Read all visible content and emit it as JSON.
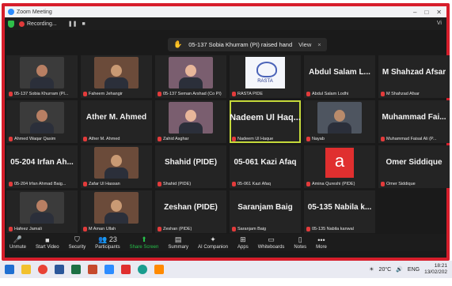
{
  "window": {
    "title": "Zoom Meeting"
  },
  "recording": {
    "label": "Recording...",
    "pause": "❚❚",
    "stop": "■"
  },
  "view_label": "Vi",
  "notification": {
    "text": "05-137 Sobia Khurram (PI) raised hand",
    "view": "View",
    "close": "×"
  },
  "participants": [
    {
      "name": "05-137 Sobia Khurram (PI...",
      "kind": "video"
    },
    {
      "name": "Faheem Jehangir",
      "kind": "video"
    },
    {
      "name": "05-137 Seman Arshad (Co PI)",
      "kind": "video"
    },
    {
      "name": "RASTA PIDE",
      "kind": "logo",
      "logo_text": "RASTA"
    },
    {
      "name": "Abdul Salam Lodhi",
      "kind": "text",
      "display": "Abdul Salam L..."
    },
    {
      "name": "M Shahzad Afsar",
      "kind": "text",
      "display": "M Shahzad Afsar"
    },
    {
      "name": "Ahmed Waqar Qasim",
      "kind": "video"
    },
    {
      "name": "Ather M. Ahmed",
      "kind": "text",
      "display": "Ather M. Ahmed"
    },
    {
      "name": "Zahid Asghar",
      "kind": "video"
    },
    {
      "name": "Nadeem Ul Haque",
      "kind": "text",
      "display": "Nadeem Ul Haq...",
      "active": true
    },
    {
      "name": "Nayab",
      "kind": "video"
    },
    {
      "name": "Muhammad Faisal Ali (P...",
      "kind": "text",
      "display": "Muhammad Fai..."
    },
    {
      "name": "05-204 Irfan Ahmad Baig...",
      "kind": "text",
      "display": "05-204 Irfan Ah..."
    },
    {
      "name": "Zafar Ul Hassan",
      "kind": "video"
    },
    {
      "name": "Shahid (PIDE)",
      "kind": "text",
      "display": "Shahid (PIDE)"
    },
    {
      "name": "05-061 Kazi Afaq",
      "kind": "text",
      "display": "05-061 Kazi Afaq"
    },
    {
      "name": "Amina Qureshi (PIDE)",
      "kind": "logo_a",
      "logo_text": "a"
    },
    {
      "name": "Omer Siddique",
      "kind": "text",
      "display": "Omer Siddique"
    },
    {
      "name": "Hafeez Jamali",
      "kind": "video"
    },
    {
      "name": "M Aman Ullah",
      "kind": "video"
    },
    {
      "name": "Zeshan (PIDE)",
      "kind": "text",
      "display": "Zeshan (PIDE)"
    },
    {
      "name": "Saranjam Baig",
      "kind": "text",
      "display": "Saranjam Baig"
    },
    {
      "name": "05-135 Nabila kanwal",
      "kind": "text",
      "display": "05-135 Nabila k..."
    }
  ],
  "toolbar": {
    "unmute": "Unmute",
    "start_video": "Start Video",
    "security": "Security",
    "participants": "Participants",
    "participants_count": "23",
    "share_screen": "Share Screen",
    "summary": "Summary",
    "ai_companion": "AI Companion",
    "apps": "Apps",
    "whiteboards": "Whiteboards",
    "notes": "Notes",
    "more": "More"
  },
  "taskbar": {
    "weather": "20°C",
    "language": "ENG",
    "time": "18:21",
    "date": "13/02/202"
  },
  "colors": {
    "frame_border": "#d71e2b",
    "tile_bg": "#242424",
    "active_speaker": "#c5d93a",
    "share_green": "#26c04a"
  }
}
